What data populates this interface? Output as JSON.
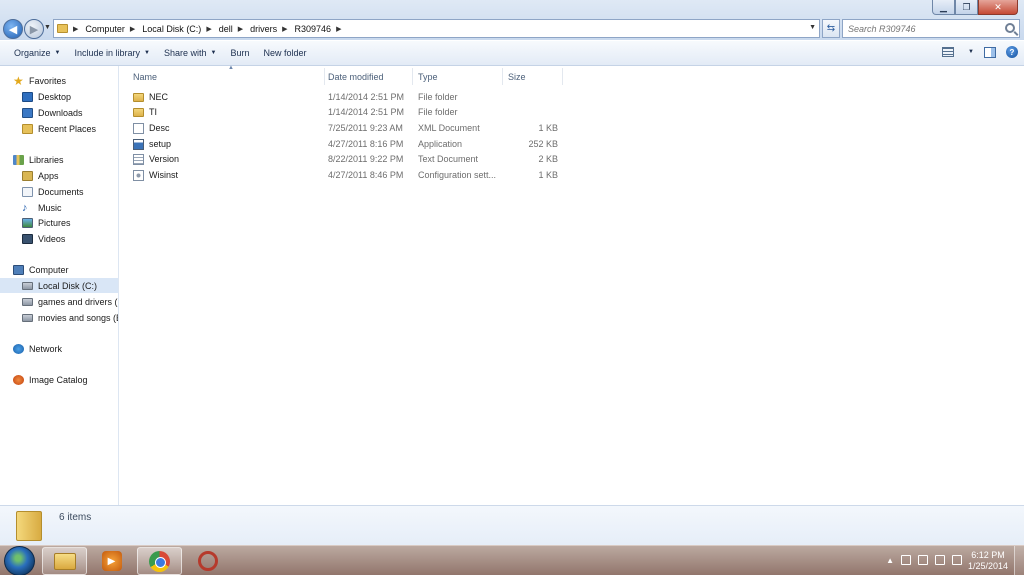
{
  "address": {
    "breadcrumbs": [
      "Computer",
      "Local Disk (C:)",
      "dell",
      "drivers",
      "R309746"
    ],
    "search_placeholder": "Search R309746"
  },
  "toolbar": {
    "organize": "Organize",
    "include_in_library": "Include in library",
    "share_with": "Share with",
    "burn": "Burn",
    "new_folder": "New folder"
  },
  "navpane": {
    "favorites": "Favorites",
    "desktop": "Desktop",
    "downloads": "Downloads",
    "recent_places": "Recent Places",
    "libraries": "Libraries",
    "apps": "Apps",
    "documents": "Documents",
    "music": "Music",
    "pictures": "Pictures",
    "videos": "Videos",
    "computer": "Computer",
    "local_disk": "Local Disk (C:)",
    "games_drivers": "games and drivers (I",
    "movies_songs": "movies and songs (E",
    "network": "Network",
    "image_catalog": "Image Catalog"
  },
  "columns": {
    "name": "Name",
    "date_modified": "Date modified",
    "type": "Type",
    "size": "Size"
  },
  "files": [
    {
      "name": "NEC",
      "date": "1/14/2014 2:51 PM",
      "type": "File folder",
      "size": "",
      "icon": "folder-icon"
    },
    {
      "name": "TI",
      "date": "1/14/2014 2:51 PM",
      "type": "File folder",
      "size": "",
      "icon": "folder-icon"
    },
    {
      "name": "Desc",
      "date": "7/25/2011 9:23 AM",
      "type": "XML Document",
      "size": "1 KB",
      "icon": "xml-file-icon"
    },
    {
      "name": "setup",
      "date": "4/27/2011 8:16 PM",
      "type": "Application",
      "size": "252 KB",
      "icon": "application-icon"
    },
    {
      "name": "Version",
      "date": "8/22/2011 9:22 PM",
      "type": "Text Document",
      "size": "2 KB",
      "icon": "text-file-icon"
    },
    {
      "name": "Wisinst",
      "date": "4/27/2011 8:46 PM",
      "type": "Configuration sett...",
      "size": "1 KB",
      "icon": "config-file-icon"
    }
  ],
  "details": {
    "item_count": "6 items"
  },
  "taskbar": {
    "time": "6:12 PM",
    "date": "1/25/2014"
  },
  "colors": {
    "selection": "#d9e6f6",
    "toolbar_text": "#1c2f4f",
    "secondary_text": "#6d6d6d"
  }
}
